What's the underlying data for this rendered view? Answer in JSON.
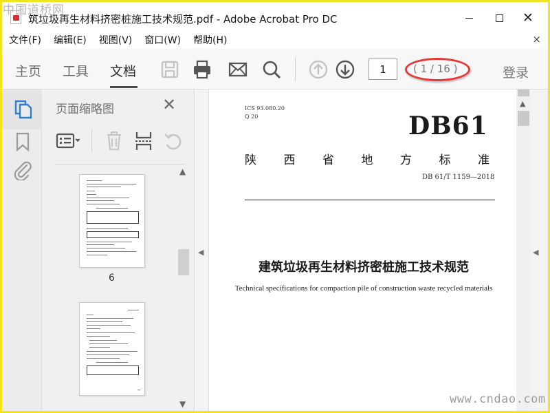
{
  "window": {
    "title": "筑垃圾再生材料挤密桩施工技术规范.pdf - Adobe Acrobat Pro DC",
    "minimize_label": "",
    "maximize_label": "",
    "close_label": "✕"
  },
  "watermarks": {
    "top_left": "中国道桥网",
    "bottom_right": "www.cndao.com"
  },
  "menubar": {
    "items": [
      {
        "label": "文件(F)"
      },
      {
        "label": "编辑(E)"
      },
      {
        "label": "视图(V)"
      },
      {
        "label": "窗口(W)"
      },
      {
        "label": "帮助(H)"
      }
    ],
    "close_label": "×"
  },
  "toolbar": {
    "tabs": [
      {
        "label": "主页"
      },
      {
        "label": "工具"
      },
      {
        "label": "文档",
        "active": true
      }
    ],
    "icons": [
      "save-icon",
      "print-icon",
      "email-icon",
      "search-icon",
      "page-up-icon",
      "page-down-icon"
    ],
    "current_page": "1",
    "page_count": "( 1 / 16 )",
    "login_label": "登录",
    "highlight_color": "#e53935"
  },
  "leftstrip": {
    "icons": [
      "page-thumbnails-icon",
      "bookmark-icon",
      "attachment-icon"
    ],
    "accent_color": "#2d7fcb"
  },
  "thumbnail_pane": {
    "title": "页面缩略图",
    "close_label": "✕",
    "tool_icons": [
      "thumbnail-options-icon",
      "delete-icon",
      "insert-page-icon",
      "rotate-icon"
    ],
    "pages": [
      {
        "number": "6"
      },
      {
        "number": ""
      }
    ]
  },
  "document": {
    "ics": "ICS 93.080.20",
    "ccs": "Q 20",
    "code": "DB61",
    "province_chars": [
      "陕",
      "西",
      "省",
      "地",
      "方",
      "标",
      "准"
    ],
    "standard_number": "DB 61/T 1159—2018",
    "title_cn": "建筑垃圾再生材料挤密桩施工技术规范",
    "title_en": "Technical specifications for compaction pile of construction waste recycled materials"
  }
}
